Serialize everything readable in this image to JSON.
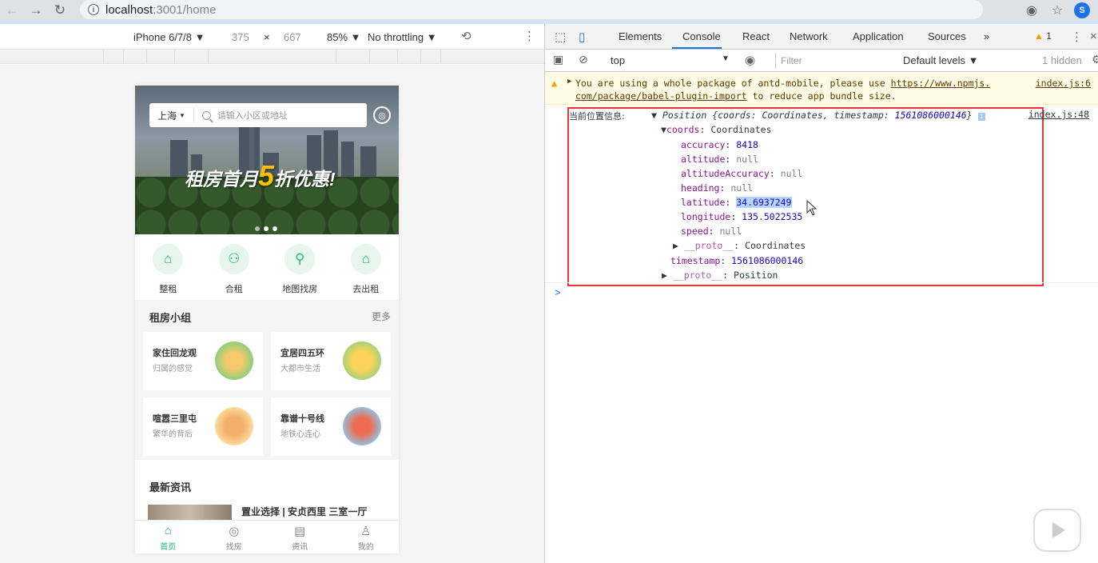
{
  "browser": {
    "url_host": "localhost",
    "url_path": ":3001/home"
  },
  "device_toolbar": {
    "device": "iPhone 6/7/8",
    "width": "375",
    "times": "×",
    "height": "667",
    "zoom": "85%",
    "throttling": "No throttling"
  },
  "phone": {
    "city": "上海",
    "search_placeholder": "请输入小区或地址",
    "banner_text_a": "租房首月",
    "banner_text_num": "5",
    "banner_text_b": "折优惠!",
    "quick_nav": [
      "整租",
      "合租",
      "地图找房",
      "去出租"
    ],
    "groups_title": "租房小组",
    "groups_more": "更多",
    "groups": [
      {
        "name": "家住回龙观",
        "desc": "归属的感觉"
      },
      {
        "name": "宜居四五环",
        "desc": "大都市生活"
      },
      {
        "name": "喧嚣三里屯",
        "desc": "繁华的背后"
      },
      {
        "name": "靠谱十号线",
        "desc": "地铁心连心"
      }
    ],
    "news_title": "最新资讯",
    "news_headline": "置业选择 | 安贞西里 三室一厅",
    "tabs": [
      "首页",
      "找房",
      "资讯",
      "我的"
    ]
  },
  "devtools": {
    "tabs": [
      "Elements",
      "Console",
      "React",
      "Network",
      "Application",
      "Sources"
    ],
    "more_tabs": "»",
    "warning_count": "1",
    "context": "top",
    "filter_placeholder": "Filter",
    "levels": "Default levels",
    "hidden": "1 hidden",
    "warning_line1": "You are using a whole package of antd-mobile, please use ",
    "warning_link": "https://www.npmjs.",
    "warning_line2_link": "com/package/babel-plugin-import",
    "warning_line2_rest": " to reduce app bundle size.",
    "warning_source": "index.js:6",
    "log": {
      "label": "当前位置信息:",
      "summary_a": "Position {coords: Coordinates, timestamp: ",
      "summary_ts": "1561086000146",
      "summary_b": "}",
      "source": "index.js:48",
      "coords_key": "coords",
      "coords_type": "Coordinates",
      "accuracy_key": "accuracy",
      "accuracy": "8418",
      "altitude_key": "altitude",
      "altitude": "null",
      "altitudeAccuracy_key": "altitudeAccuracy",
      "altitudeAccuracy": "null",
      "heading_key": "heading",
      "heading": "null",
      "latitude_key": "latitude",
      "latitude": "34.6937249",
      "longitude_key": "longitude",
      "longitude": "135.5022535",
      "speed_key": "speed",
      "speed": "null",
      "proto_key": "__proto__",
      "proto_coords": "Coordinates",
      "timestamp_key": "timestamp",
      "timestamp": "1561086000146",
      "proto_position": "Position"
    },
    "prompt": ">"
  },
  "colors": {
    "accent": "#21b97a",
    "highlight_box": "#e53935",
    "devtools_blue": "#1a73e8"
  }
}
